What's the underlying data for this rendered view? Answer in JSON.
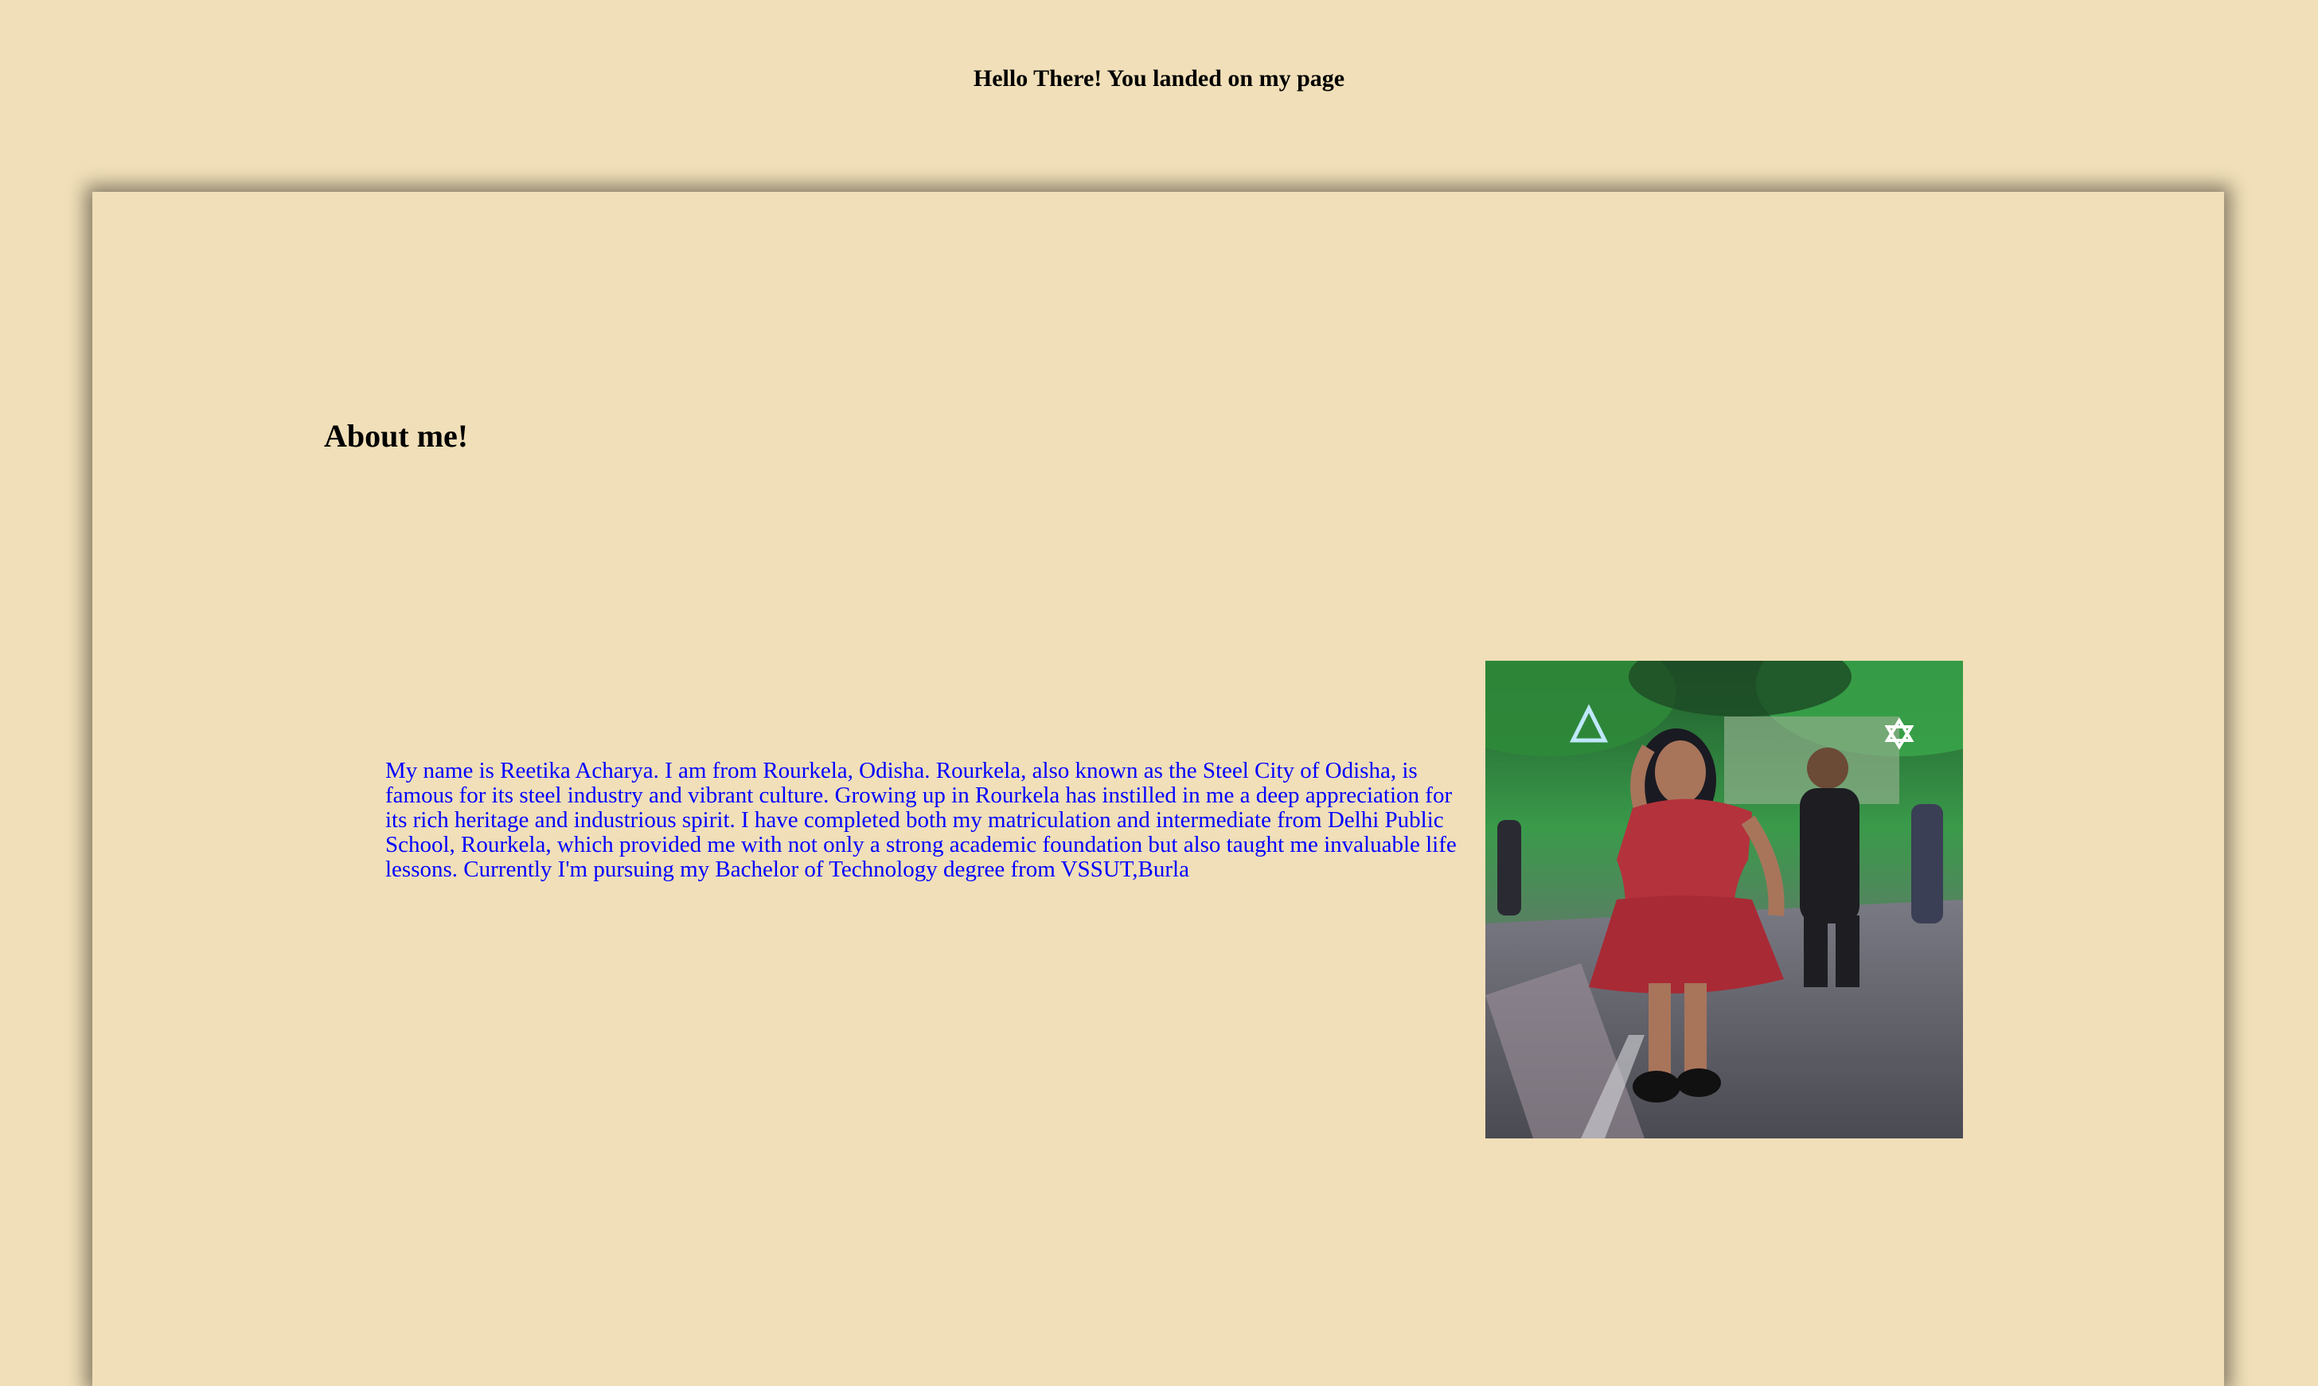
{
  "header": {
    "title": "Hello There! You landed on my page"
  },
  "about": {
    "heading": "About me!",
    "text": "My name is Reetika Acharya. I am from Rourkela, Odisha. Rourkela, also known as the Steel City of Odisha, is famous for its steel industry and vibrant culture. Growing up in Rourkela has instilled in me a deep appreciation for its rich heritage and industrious spirit. I have completed both my matriculation and intermediate from Delhi Public School, Rourkela, which provided me with not only a strong academic foundation but also taught me invaluable life lessons. Currently I'm pursuing my Bachelor of Technology degree from VSSUT,Burla"
  },
  "photo": {
    "subject": "profile-photo",
    "colors": {
      "foliage": "#2f8a3a",
      "dress": "#b4323c",
      "road": "#6f6f78"
    }
  },
  "colors": {
    "background": "#f0dfb8",
    "text_accent": "#0000ff"
  }
}
